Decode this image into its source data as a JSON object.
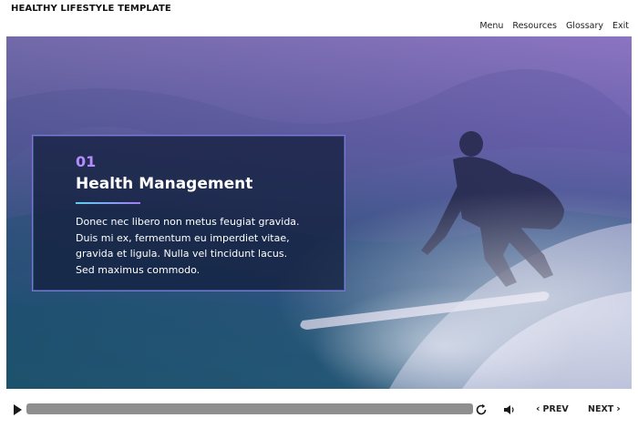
{
  "app": {
    "title": "HEALTHY LIFESTYLE TEMPLATE"
  },
  "nav": {
    "items": [
      {
        "label": "Menu"
      },
      {
        "label": "Resources"
      },
      {
        "label": "Glossary"
      },
      {
        "label": "Exit"
      }
    ]
  },
  "slide": {
    "number": "01",
    "title": "Health Management",
    "body_lines": [
      "Donec nec libero non metus feugiat gravida.",
      "Duis mi ex, fermentum eu imperdiet vitae,",
      "gravida et ligula. Nulla vel tincidunt lacus.",
      "Sed maximus commodo."
    ],
    "background_image": "surfer-riding-wave-photo"
  },
  "player": {
    "progress": 0,
    "prev_label": "PREV",
    "next_label": "NEXT",
    "icons": {
      "play": "play-icon",
      "replay": "replay-icon",
      "volume": "volume-icon",
      "prev": "chevron-left-icon",
      "next": "chevron-right-icon"
    }
  },
  "colors": {
    "accent": "#b58cff",
    "card_border": "#8a6fe0",
    "rule_start": "#5bd1ef",
    "rule_end": "#a47cf5",
    "progress_track": "#8f8f8f"
  }
}
